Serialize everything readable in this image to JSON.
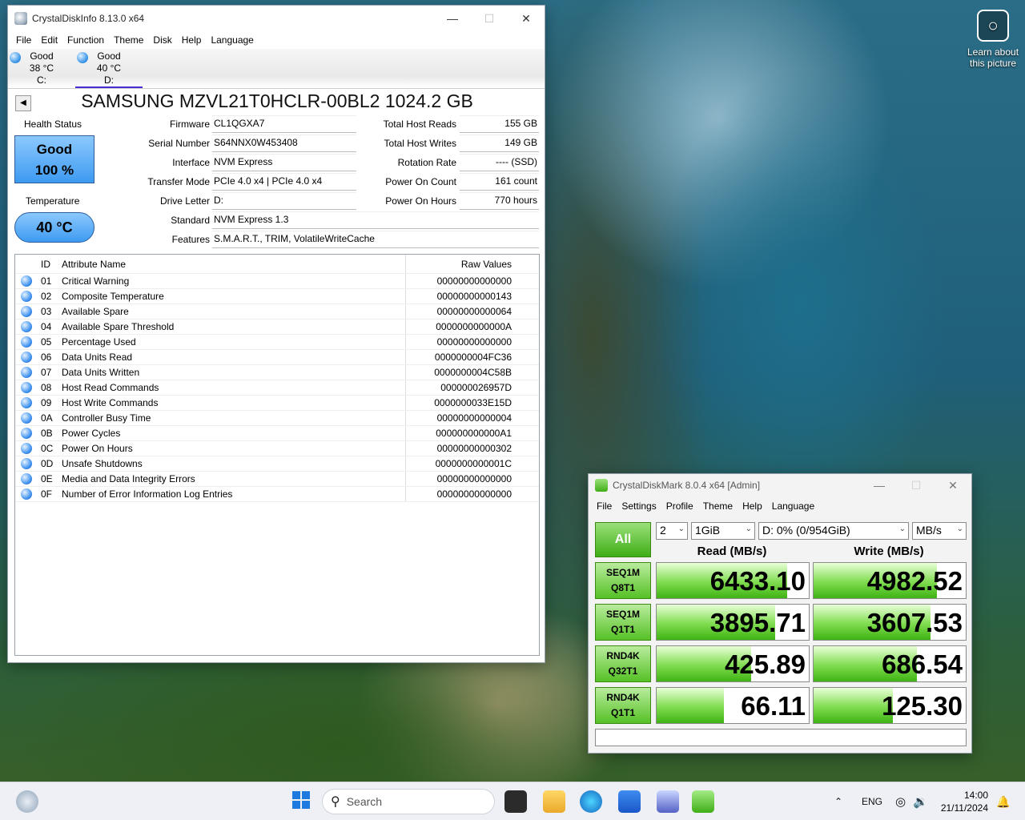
{
  "cdi": {
    "title": "CrystalDiskInfo 8.13.0 x64",
    "menu": [
      "File",
      "Edit",
      "Function",
      "Theme",
      "Disk",
      "Help",
      "Language"
    ],
    "drives": [
      {
        "status": "Good",
        "temp": "38 °C",
        "letter": "C:"
      },
      {
        "status": "Good",
        "temp": "40 °C",
        "letter": "D:"
      }
    ],
    "disk_title": "SAMSUNG MZVL21T0HCLR-00BL2 1024.2 GB",
    "health_label": "Health Status",
    "health_status": "Good",
    "health_percent": "100 %",
    "temp_label": "Temperature",
    "temp_value": "40 °C",
    "fields": {
      "firmware": {
        "label": "Firmware",
        "value": "CL1QGXA7"
      },
      "serial": {
        "label": "Serial Number",
        "value": "S64NNX0W453408"
      },
      "interface": {
        "label": "Interface",
        "value": "NVM Express"
      },
      "transfer": {
        "label": "Transfer Mode",
        "value": "PCIe 4.0 x4 | PCIe 4.0 x4"
      },
      "drive_letter": {
        "label": "Drive Letter",
        "value": "D:"
      },
      "standard": {
        "label": "Standard",
        "value": "NVM Express 1.3"
      },
      "features": {
        "label": "Features",
        "value": "S.M.A.R.T., TRIM, VolatileWriteCache"
      },
      "host_reads": {
        "label": "Total Host Reads",
        "value": "155 GB"
      },
      "host_writes": {
        "label": "Total Host Writes",
        "value": "149 GB"
      },
      "rotation": {
        "label": "Rotation Rate",
        "value": "---- (SSD)"
      },
      "power_count": {
        "label": "Power On Count",
        "value": "161 count"
      },
      "power_hours": {
        "label": "Power On Hours",
        "value": "770 hours"
      }
    },
    "table_headers": {
      "id": "ID",
      "name": "Attribute Name",
      "raw": "Raw Values"
    },
    "attributes": [
      {
        "id": "01",
        "name": "Critical Warning",
        "raw": "00000000000000"
      },
      {
        "id": "02",
        "name": "Composite Temperature",
        "raw": "00000000000143"
      },
      {
        "id": "03",
        "name": "Available Spare",
        "raw": "00000000000064"
      },
      {
        "id": "04",
        "name": "Available Spare Threshold",
        "raw": "0000000000000A"
      },
      {
        "id": "05",
        "name": "Percentage Used",
        "raw": "00000000000000"
      },
      {
        "id": "06",
        "name": "Data Units Read",
        "raw": "0000000004FC36"
      },
      {
        "id": "07",
        "name": "Data Units Written",
        "raw": "0000000004C58B"
      },
      {
        "id": "08",
        "name": "Host Read Commands",
        "raw": "000000026957D"
      },
      {
        "id": "09",
        "name": "Host Write Commands",
        "raw": "0000000033E15D"
      },
      {
        "id": "0A",
        "name": "Controller Busy Time",
        "raw": "00000000000004"
      },
      {
        "id": "0B",
        "name": "Power Cycles",
        "raw": "000000000000A1"
      },
      {
        "id": "0C",
        "name": "Power On Hours",
        "raw": "00000000000302"
      },
      {
        "id": "0D",
        "name": "Unsafe Shutdowns",
        "raw": "0000000000001C"
      },
      {
        "id": "0E",
        "name": "Media and Data Integrity Errors",
        "raw": "00000000000000"
      },
      {
        "id": "0F",
        "name": "Number of Error Information Log Entries",
        "raw": "00000000000000"
      }
    ]
  },
  "cdm": {
    "title": "CrystalDiskMark 8.0.4 x64 [Admin]",
    "menu": [
      "File",
      "Settings",
      "Profile",
      "Theme",
      "Help",
      "Language"
    ],
    "all_label": "All",
    "count": "2",
    "size": "1GiB",
    "drive": "D: 0% (0/954GiB)",
    "unit": "MB/s",
    "read_header": "Read (MB/s)",
    "write_header": "Write (MB/s)",
    "tests": [
      {
        "line1": "SEQ1M",
        "line2": "Q8T1",
        "read": "6433.10",
        "write": "4982.52",
        "read_fill": 0.86,
        "write_fill": 0.81
      },
      {
        "line1": "SEQ1M",
        "line2": "Q1T1",
        "read": "3895.71",
        "write": "3607.53",
        "read_fill": 0.78,
        "write_fill": 0.77
      },
      {
        "line1": "RND4K",
        "line2": "Q32T1",
        "read": "425.89",
        "write": "686.54",
        "read_fill": 0.62,
        "write_fill": 0.68
      },
      {
        "line1": "RND4K",
        "line2": "Q1T1",
        "read": "66.11",
        "write": "125.30",
        "read_fill": 0.44,
        "write_fill": 0.52
      }
    ]
  },
  "desktop": {
    "learn_text": "Learn about this picture"
  },
  "taskbar": {
    "search_placeholder": "Search",
    "lang": "ENG",
    "time": "14:00",
    "date": "21/11/2024"
  }
}
